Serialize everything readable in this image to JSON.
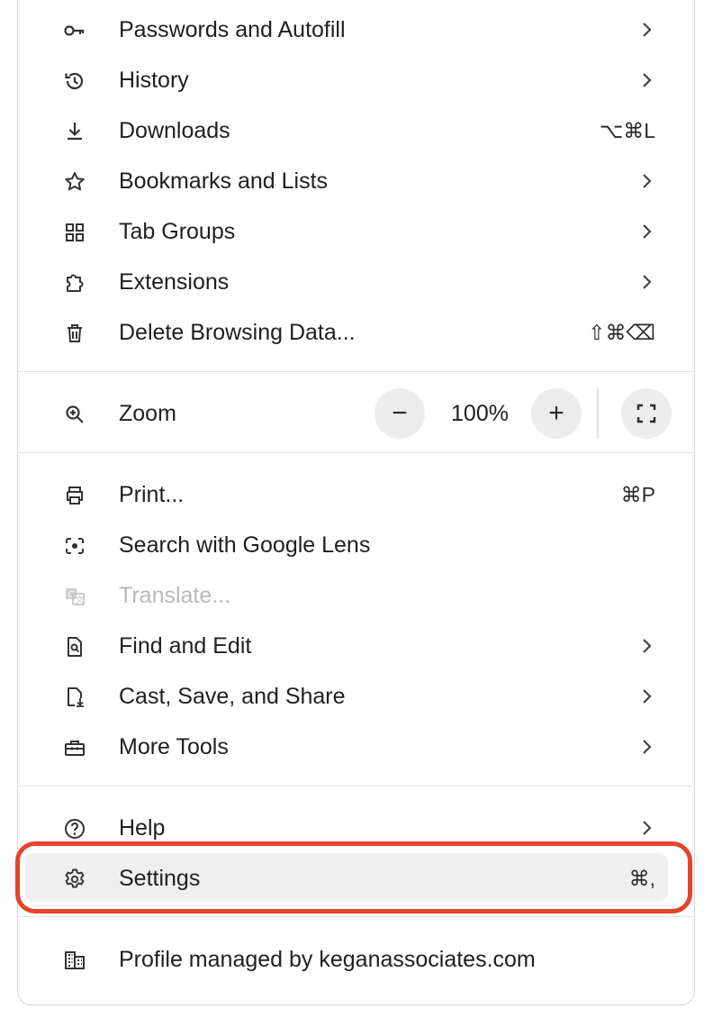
{
  "menu": {
    "items": [
      {
        "name": "passwords",
        "label": "Passwords and Autofill",
        "icon": "key-icon",
        "trailing": "chevron"
      },
      {
        "name": "history",
        "label": "History",
        "icon": "history-icon",
        "trailing": "chevron"
      },
      {
        "name": "downloads",
        "label": "Downloads",
        "icon": "download-icon",
        "shortcut": "⌥⌘L"
      },
      {
        "name": "bookmarks",
        "label": "Bookmarks and Lists",
        "icon": "star-icon",
        "trailing": "chevron"
      },
      {
        "name": "tab-groups",
        "label": "Tab Groups",
        "icon": "grid-icon",
        "trailing": "chevron"
      },
      {
        "name": "extensions",
        "label": "Extensions",
        "icon": "puzzle-icon",
        "trailing": "chevron"
      },
      {
        "name": "delete-browsing-data",
        "label": "Delete Browsing Data...",
        "icon": "trash-icon",
        "shortcut": "⇧⌘⌫"
      }
    ],
    "zoom": {
      "label": "Zoom",
      "value": "100%",
      "minus": "−",
      "plus": "+"
    },
    "tools": [
      {
        "name": "print",
        "label": "Print...",
        "icon": "printer-icon",
        "shortcut": "⌘P"
      },
      {
        "name": "google-lens",
        "label": "Search with Google Lens",
        "icon": "lens-icon"
      },
      {
        "name": "translate",
        "label": "Translate...",
        "icon": "translate-icon",
        "disabled": true
      },
      {
        "name": "find-edit",
        "label": "Find and Edit",
        "icon": "find-page-icon",
        "trailing": "chevron"
      },
      {
        "name": "cast-save-share",
        "label": "Cast, Save, and Share",
        "icon": "save-page-icon",
        "trailing": "chevron"
      },
      {
        "name": "more-tools",
        "label": "More Tools",
        "icon": "toolbox-icon",
        "trailing": "chevron"
      }
    ],
    "help": {
      "label": "Help",
      "icon": "help-icon"
    },
    "settings": {
      "label": "Settings",
      "icon": "gear-icon",
      "shortcut": "⌘,"
    },
    "profile": {
      "label": "Profile managed by keganassociates.com",
      "icon": "building-icon"
    }
  },
  "colors": {
    "highlight_border": "#e5432b",
    "hover_bg": "#efefef",
    "text": "#1f1f1f",
    "disabled_text": "#b9b9b9"
  }
}
